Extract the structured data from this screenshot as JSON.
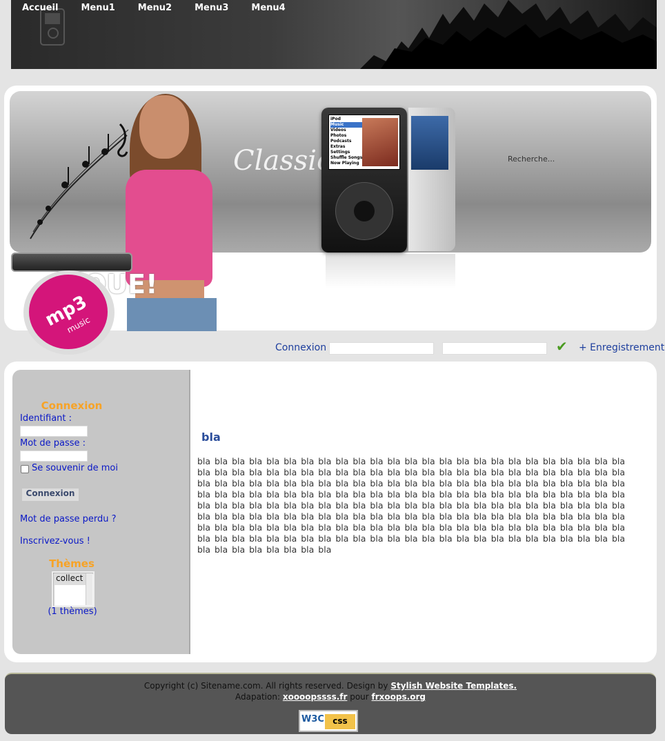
{
  "nav": {
    "items": [
      "Accueil",
      "Menu1",
      "Menu2",
      "Menu3",
      "Menu4"
    ]
  },
  "banner": {
    "script_text": "Classic",
    "search_placeholder": "Recherche...",
    "ipod_menu": [
      "iPod",
      "Music",
      "Videos",
      "Photos",
      "Podcasts",
      "Extras",
      "Settings",
      "Shuffle Songs",
      "Now Playing"
    ],
    "badge_text": "mp3",
    "badge_sub": "music",
    "exclaim": "OUE!"
  },
  "login_bar": {
    "label": "Connexion",
    "register": "+ Enregistrement"
  },
  "sidebar": {
    "login_heading": "Connexion",
    "identifiant": "Identifiant :",
    "password": "Mot de passe :",
    "remember": "Se souvenir de moi",
    "submit": "Connexion",
    "lost_password": "Mot de passe perdu ?",
    "register": "Inscrivez-vous !",
    "themes_heading": "Thèmes",
    "theme_option": "collect",
    "themes_count": "(1 thèmes)"
  },
  "content": {
    "title": "bla",
    "body": "bla bla bla bla bla bla bla bla bla bla bla bla bla bla bla bla bla bla bla bla bla bla bla bla bla bla bla bla bla bla bla bla bla bla bla bla bla bla bla bla bla bla bla bla bla bla bla bla bla bla bla bla bla bla bla bla bla bla bla bla bla bla bla bla bla bla bla bla bla bla bla bla bla bla bla bla bla bla bla bla bla bla bla bla bla bla bla bla bla bla bla bla bla bla bla bla bla bla bla bla bla bla bla bla bla bla bla bla bla bla bla bla bla bla bla bla bla bla bla bla bla bla bla bla bla bla bla bla bla bla bla bla bla bla bla bla bla bla bla bla bla bla bla bla bla bla bla bla bla bla bla bla bla bla bla bla bla bla bla bla bla bla bla bla bla bla bla bla bla bla bla bla bla bla bla bla bla bla bla bla bla bla bla bla bla bla bla bla bla bla bla bla bla bla bla bla bla bla bla bla bla bla bla bla bla bla bla bla"
  },
  "footer": {
    "copyright_prefix": "Copyright (c) Sitename.com. All rights reserved. Design by ",
    "design_link": "Stylish Website Templates.",
    "adaptation_prefix": "Adapation: ",
    "adaptation_link": "xoooopssss.fr",
    "pour": " pour ",
    "pour_link": "frxoops.org",
    "badge_w3c": "W3C",
    "badge_css": "css"
  },
  "colors": {
    "link_blue": "#1e3f9e",
    "heading_orange": "#f7a326",
    "badge_pink": "#d4157a"
  }
}
